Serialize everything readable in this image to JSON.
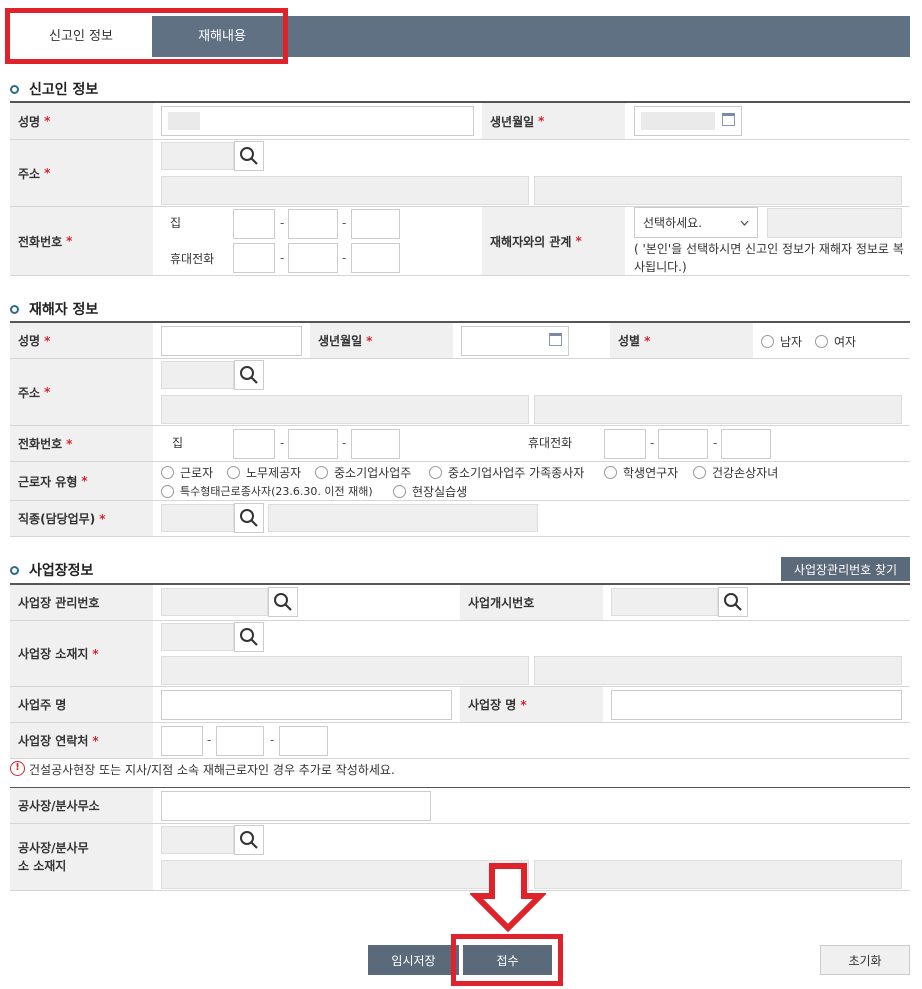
{
  "tabs": [
    {
      "label": "신고인 정보"
    },
    {
      "label": "재해내용"
    }
  ],
  "required_mark": "*",
  "reporter": {
    "title": "신고인 정보",
    "name_label": "성명",
    "birth_label": "생년월일",
    "address_label": "주소",
    "phone_label": "전화번호",
    "home_label": "집",
    "mobile_label": "휴대전화",
    "relation_label": "재해자와의 관계",
    "relation_select": "선택하세요.",
    "relation_note": "( '본인'을 선택하시면 신고인 정보가 재해자 정보로 복사됩니다.)"
  },
  "victim": {
    "title": "재해자 정보",
    "name_label": "성명",
    "birth_label": "생년월일",
    "gender_label": "성별",
    "gender_options": [
      "남자",
      "여자"
    ],
    "address_label": "주소",
    "phone_label": "전화번호",
    "home_label": "집",
    "mobile_label": "휴대전화",
    "worker_type_label": "근로자 유형",
    "worker_types": [
      "근로자",
      "노무제공자",
      "중소기업사업주",
      "중소기업사업주 가족종사자",
      "학생연구자",
      "건강손상자녀",
      "특수형태근로종사자(23.6.30. 이전 재해)",
      "현장실습생"
    ],
    "job_label": "직종(담당업무)"
  },
  "workplace": {
    "title": "사업장정보",
    "find_button": "사업장관리번호 찾기",
    "mgmt_no_label": "사업장 관리번호",
    "start_no_label": "사업개시번호",
    "location_label": "사업장 소재지",
    "owner_label": "사업주 명",
    "name_label": "사업장 명",
    "contact_label": "사업장 연락처",
    "notice": "건설공사현장 또는 지사/지점 소속 재해근로자인 경우 추가로 작성하세요.",
    "branch_label": "공사장/분사무소",
    "branch_location_label": "공사장/분사무소 소재지"
  },
  "buttons": {
    "temp_save": "임시저장",
    "submit": "접수",
    "reset": "초기화"
  },
  "colors": {
    "accent": "#607183",
    "highlight": "#e0232b",
    "required": "#d0282e"
  },
  "phone_dash": "-"
}
